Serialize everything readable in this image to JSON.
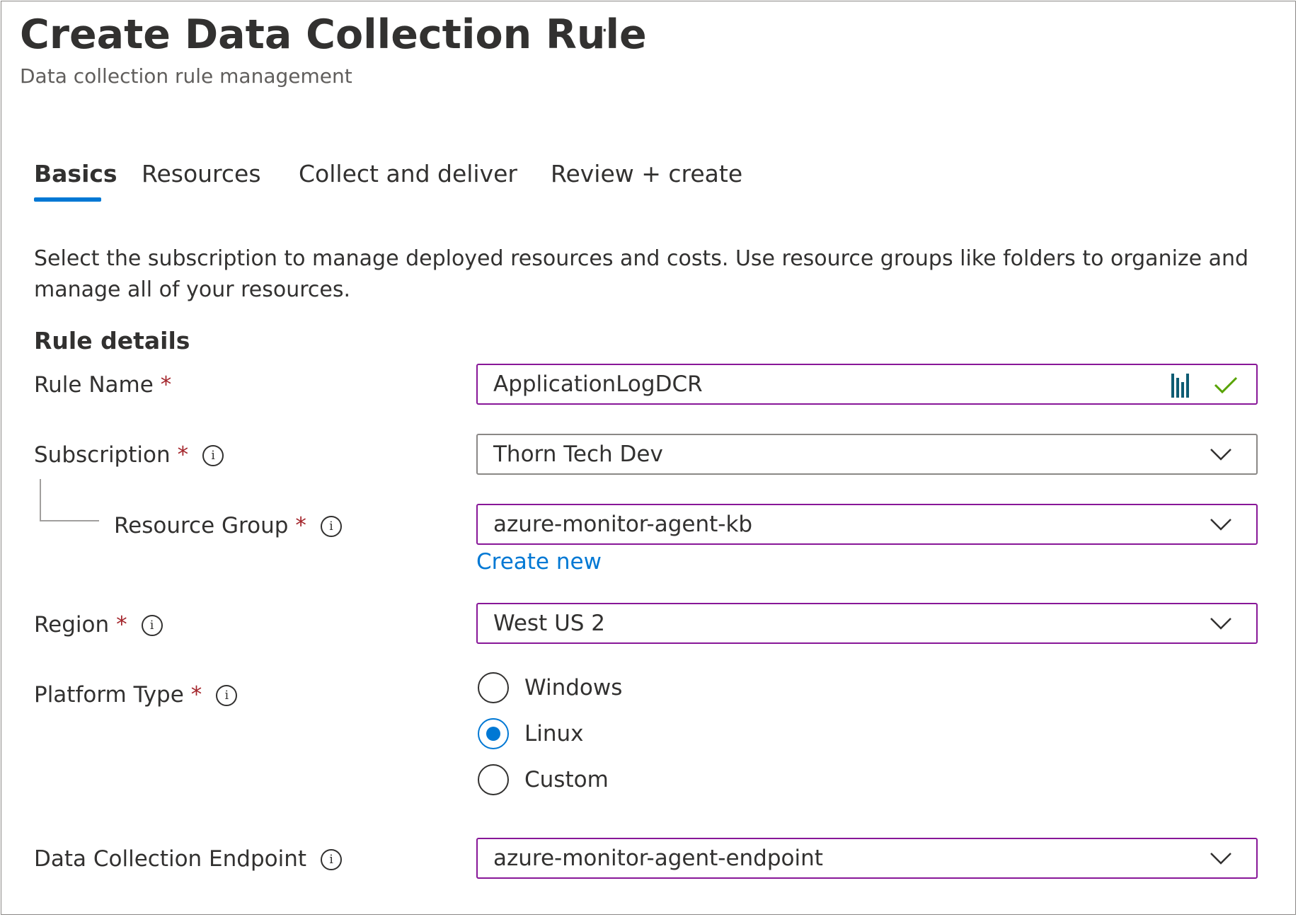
{
  "header": {
    "title": "Create Data Collection Rule",
    "more_label": "···",
    "subtitle": "Data collection rule management"
  },
  "tabs": [
    {
      "label": "Basics",
      "active": true
    },
    {
      "label": "Resources",
      "active": false
    },
    {
      "label": "Collect and deliver",
      "active": false
    },
    {
      "label": "Review + create",
      "active": false
    }
  ],
  "intro": "Select the subscription to manage deployed resources and costs. Use resource groups like folders to organize and manage all of your resources.",
  "section": {
    "heading": "Rule details"
  },
  "form": {
    "required_mark": "*",
    "info_glyph": "i",
    "rule_name": {
      "label": "Rule Name",
      "value": "ApplicationLogDCR"
    },
    "subscription": {
      "label": "Subscription",
      "value": "Thorn Tech Dev"
    },
    "resource_group": {
      "label": "Resource Group",
      "value": "azure-monitor-agent-kb",
      "create_new_label": "Create new"
    },
    "region": {
      "label": "Region",
      "value": "West US 2"
    },
    "platform_type": {
      "label": "Platform Type",
      "options": [
        {
          "label": "Windows",
          "checked": false
        },
        {
          "label": "Linux",
          "checked": true
        },
        {
          "label": "Custom",
          "checked": false
        }
      ]
    },
    "endpoint": {
      "label": "Data Collection Endpoint",
      "value": "azure-monitor-agent-endpoint"
    }
  },
  "colors": {
    "accent": "#0078d4",
    "focus_border": "#881798",
    "required": "#a4262c",
    "valid_check": "#57a300",
    "extension_icon": "#0d5c73"
  },
  "icons": {
    "more": "ellipsis-icon",
    "info": "info-icon",
    "dropdown": "chevron-down-icon",
    "valid": "checkmark-icon",
    "extension": "password-manager-icon"
  }
}
